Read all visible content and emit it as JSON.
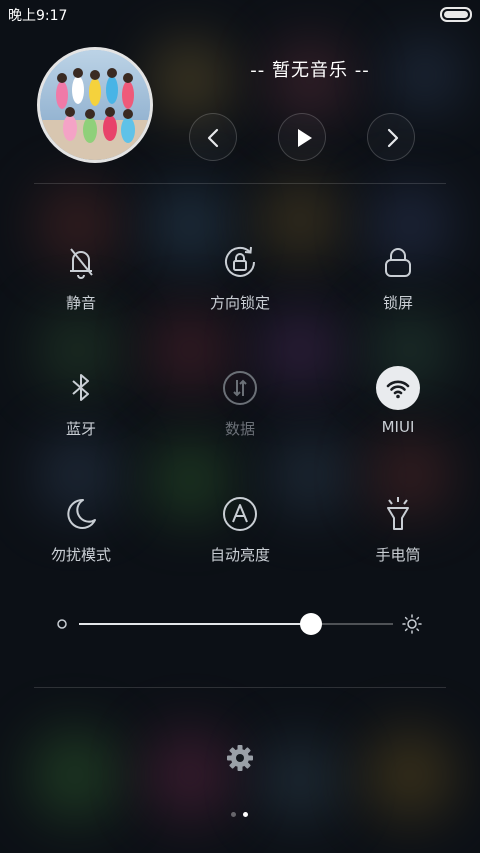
{
  "status_bar": {
    "time": "晚上9:17"
  },
  "music": {
    "title": "-- 暂无音乐 --",
    "prev_icon": "chevron-left-icon",
    "play_icon": "play-icon",
    "next_icon": "chevron-right-icon"
  },
  "toggles": [
    {
      "id": "silent",
      "label": "静音",
      "icon": "bell-off-icon",
      "state": "off"
    },
    {
      "id": "rotation-lock",
      "label": "方向锁定",
      "icon": "rotation-lock-icon",
      "state": "off"
    },
    {
      "id": "lock-screen",
      "label": "锁屏",
      "icon": "padlock-icon",
      "state": "off"
    },
    {
      "id": "bluetooth",
      "label": "蓝牙",
      "icon": "bluetooth-icon",
      "state": "off"
    },
    {
      "id": "data",
      "label": "数据",
      "icon": "mobile-data-icon",
      "state": "disabled"
    },
    {
      "id": "wifi",
      "label": "MIUI",
      "icon": "wifi-icon",
      "state": "on"
    },
    {
      "id": "do-not-disturb",
      "label": "勿扰模式",
      "icon": "moon-icon",
      "state": "off"
    },
    {
      "id": "auto-brightness",
      "label": "自动亮度",
      "icon": "auto-brightness-icon",
      "state": "off"
    },
    {
      "id": "flashlight",
      "label": "手电筒",
      "icon": "flashlight-icon",
      "state": "off"
    }
  ],
  "brightness": {
    "level": 0.74,
    "min_icon": "dim-sun-icon",
    "max_icon": "bright-sun-icon"
  },
  "settings": {
    "icon": "gear-icon"
  },
  "pager": {
    "pages": 2,
    "current": 2
  },
  "colors": {
    "accent_on": "#e9ebee",
    "icon_default": "#c9ced4",
    "icon_disabled": "#6b7077"
  }
}
